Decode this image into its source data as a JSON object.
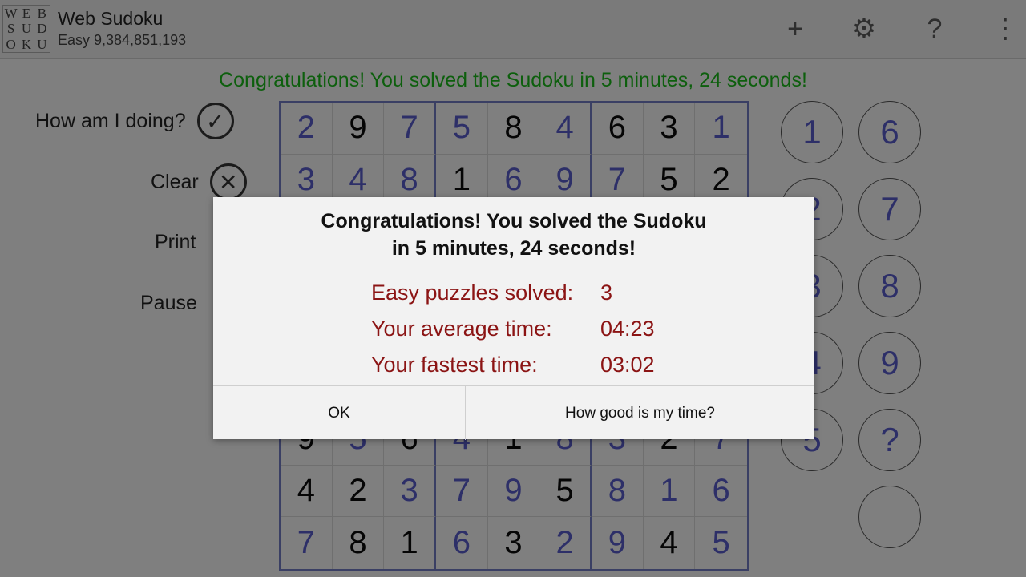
{
  "app": {
    "logo_letters": [
      "W",
      "E",
      "B",
      "S",
      "U",
      "D",
      "O",
      "K",
      "U"
    ],
    "title": "Web Sudoku",
    "subtitle": "Easy 9,384,851,193",
    "actions": [
      {
        "name": "new-puzzle-icon",
        "glyph": "+"
      },
      {
        "name": "gear-icon",
        "glyph": "⚙"
      },
      {
        "name": "help-icon",
        "glyph": "?"
      },
      {
        "name": "overflow-menu-icon",
        "glyph": "⋮"
      }
    ]
  },
  "banner": "Congratulations! You solved the Sudoku in 5 minutes, 24 seconds!",
  "side": {
    "check_label": "How am I doing?",
    "clear_label": "Clear",
    "print_label": "Print",
    "pause_label": "Pause",
    "check_icon": "✓",
    "clear_icon": "✕"
  },
  "board": {
    "rows": [
      [
        "2",
        "9",
        "7",
        "5",
        "8",
        "4",
        "6",
        "3",
        "1"
      ],
      [
        "3",
        "4",
        "8",
        "1",
        "6",
        "9",
        "7",
        "5",
        "2"
      ],
      [
        "",
        "",
        "",
        "",
        "",
        "",
        "",
        "",
        ""
      ],
      [
        "",
        "",
        "",
        "",
        "",
        "",
        "",
        "",
        ""
      ],
      [
        "",
        "",
        "",
        "",
        "",
        "",
        "",
        "",
        ""
      ],
      [
        "",
        "",
        "",
        "",
        "",
        "",
        "",
        "",
        ""
      ],
      [
        "9",
        "5",
        "6",
        "4",
        "1",
        "8",
        "3",
        "2",
        "7"
      ],
      [
        "4",
        "2",
        "3",
        "7",
        "9",
        "5",
        "8",
        "1",
        "6"
      ],
      [
        "7",
        "8",
        "1",
        "6",
        "3",
        "2",
        "9",
        "4",
        "5"
      ]
    ],
    "given": [
      [
        0,
        1,
        0,
        0,
        1,
        0,
        1,
        1,
        0
      ],
      [
        0,
        0,
        0,
        1,
        0,
        0,
        0,
        1,
        1
      ],
      [
        0,
        0,
        0,
        0,
        0,
        0,
        0,
        0,
        0
      ],
      [
        0,
        0,
        0,
        0,
        0,
        0,
        0,
        0,
        0
      ],
      [
        0,
        0,
        0,
        0,
        0,
        0,
        0,
        0,
        0
      ],
      [
        0,
        0,
        0,
        0,
        0,
        0,
        0,
        0,
        0
      ],
      [
        1,
        0,
        1,
        0,
        1,
        0,
        0,
        1,
        0
      ],
      [
        1,
        1,
        0,
        0,
        0,
        1,
        0,
        0,
        0
      ],
      [
        0,
        1,
        1,
        0,
        1,
        0,
        0,
        1,
        0
      ]
    ]
  },
  "numpad": [
    "1",
    "6",
    "2",
    "7",
    "3",
    "8",
    "4",
    "9",
    "5",
    "?",
    ""
  ],
  "dialog": {
    "title_line1": "Congratulations! You solved the Sudoku",
    "title_line2": "in 5 minutes, 24 seconds!",
    "stats": [
      {
        "label": "Easy puzzles solved:",
        "value": "3"
      },
      {
        "label": "Your average time:",
        "value": "04:23"
      },
      {
        "label": "Your fastest time:",
        "value": "03:02"
      }
    ],
    "ok_label": "OK",
    "how_label": "How good is my time?"
  }
}
